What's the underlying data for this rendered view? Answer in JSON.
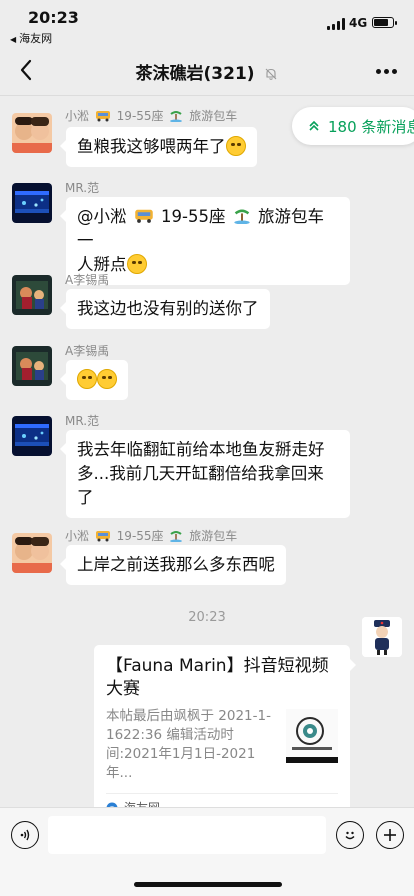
{
  "status_bar": {
    "time": "20:23",
    "back_app": "海友网",
    "network": "4G"
  },
  "nav": {
    "title": "茶沫礁岩(321)"
  },
  "new_messages": "180 条新消息",
  "messages": [
    {
      "sender_name": "小淞",
      "sender_suffix1": "19-55座",
      "sender_suffix2": "旅游包车",
      "text": "鱼粮我这够喂两年了"
    },
    {
      "sender_name": "MR.范",
      "text_part1": "@小淞",
      "text_part2": "19-55座",
      "text_part3": "旅游包车 一",
      "text_part4": "人掰点"
    },
    {
      "sender_name": "A李锡禹",
      "text": "我这边也没有别的送你了"
    },
    {
      "sender_name": "A李锡禹",
      "text": ""
    },
    {
      "sender_name": "MR.范",
      "line1": "我去年临翻缸前给本地鱼友掰走好",
      "line2": "多...我前几天开缸翻倍给我拿回来",
      "line3": "了"
    },
    {
      "sender_name": "小淞",
      "sender_suffix1": "19-55座",
      "sender_suffix2": "旅游包车",
      "text": "上岸之前送我那么多东西呢"
    }
  ],
  "time_separator": "20:23",
  "card": {
    "title": "【Fauna Marin】抖音短视频大赛",
    "desc": "本帖最后由飒枫于 2021-1-1622:36 编辑活动时间:2021年1月1日-2021年...",
    "source": "海友网"
  },
  "icons": {
    "back": "chevron-left-icon",
    "mute": "bell-mute-icon",
    "more": "more-dots-icon",
    "voice": "voice-icon",
    "emoji": "emoji-icon",
    "plus": "plus-icon"
  },
  "colors": {
    "accent": "#07a05a",
    "background": "#ededed",
    "bubble": "#ffffff"
  }
}
